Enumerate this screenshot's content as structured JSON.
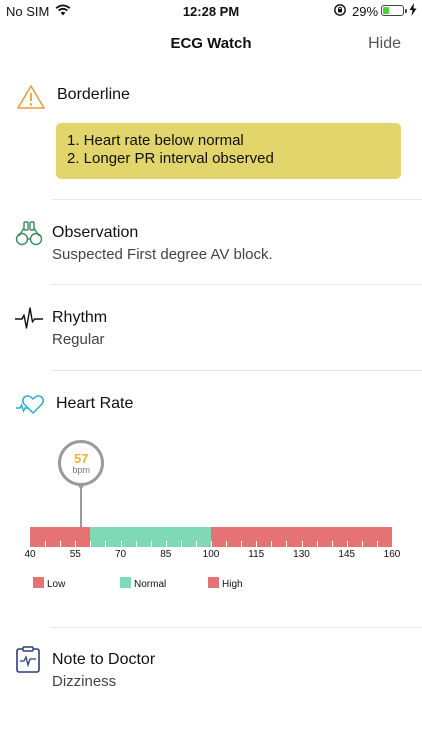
{
  "status_bar": {
    "carrier": "No SIM",
    "time": "12:28 PM",
    "battery_percent": "29%",
    "battery_level": 0.29
  },
  "nav": {
    "title": "ECG Watch",
    "hide_label": "Hide"
  },
  "sections": {
    "borderline": {
      "icon": "warning-icon",
      "title": "Borderline",
      "items": [
        "1. Heart rate below normal",
        "2. Longer PR interval observed"
      ]
    },
    "observation": {
      "icon": "binoculars-icon",
      "title": "Observation",
      "value": "Suspected First degree AV block."
    },
    "rhythm": {
      "icon": "ecg-wave-icon",
      "title": "Rhythm",
      "value": "Regular"
    },
    "heart_rate": {
      "icon": "heart-pulse-icon",
      "title": "Heart Rate",
      "value": "57",
      "unit": "bpm",
      "scale_min": 40,
      "scale_max": 160,
      "tick_labels": [
        "40",
        "55",
        "70",
        "85",
        "100",
        "115",
        "130",
        "145",
        "160"
      ],
      "ranges": [
        {
          "name": "Low",
          "from": 40,
          "to": 60,
          "color": "#e57373"
        },
        {
          "name": "Normal",
          "from": 60,
          "to": 100,
          "color": "#7fd8b6"
        },
        {
          "name": "High",
          "from": 100,
          "to": 160,
          "color": "#e57373"
        }
      ],
      "legend": [
        {
          "label": "Low",
          "color": "#e57373"
        },
        {
          "label": "Normal",
          "color": "#7fd8b6"
        },
        {
          "label": "High",
          "color": "#e57373"
        }
      ]
    },
    "note": {
      "icon": "clipboard-icon",
      "title": "Note to Doctor",
      "value": "Dizziness"
    }
  },
  "colors": {
    "alert_bg": "#e2d56c",
    "warning_icon": "#e0a23a",
    "icon_green": "#3a8a5a",
    "icon_teal": "#27b0c6",
    "icon_navy": "#2c3e7a",
    "indicator_value": "#e5b62e"
  }
}
